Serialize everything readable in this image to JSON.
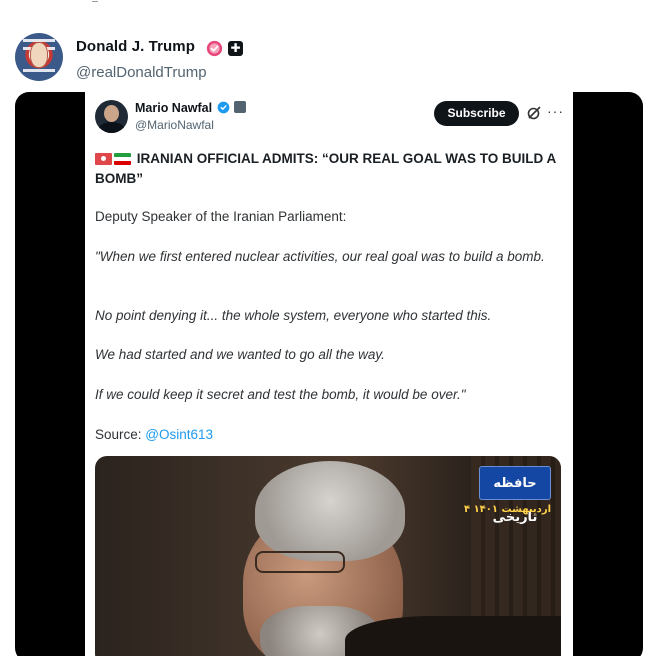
{
  "post": {
    "display_name": "Donald J. Trump",
    "handle": "@realDonaldTrump"
  },
  "quoted_tweet": {
    "name": "Mario Nawfal",
    "handle": "@MarioNawfal",
    "subscribe_label": "Subscribe",
    "more_label": "···",
    "headline": "IRANIAN OFFICIAL ADMITS: “OUR REAL GOAL WAS TO BUILD A BOMB”",
    "intro": "Deputy Speaker of the Iranian Parliament:",
    "quote_1": "\"When we first entered nuclear activities, our real goal was to build a bomb.",
    "quote_2": "No point denying it... the whole system, everyone who started this.",
    "quote_3": "We had started and we wanted to go all the way.",
    "quote_4": "If we could keep it secret and test the bomb, it would be over.\"",
    "source_label": "Source:",
    "source_handle": "@Osint613"
  },
  "video": {
    "logo_text": "حافظه تاریخی",
    "date_text": "۴ اردیبهشت ۱۴۰۱"
  },
  "colors": {
    "link": "#1d9bf0",
    "verified": "#f7a3bc",
    "subscribe_bg": "#0f1419",
    "media_bg": "#000000"
  },
  "icons": [
    "verified-badge-icon",
    "government-badge-icon",
    "grok-icon",
    "more-icon"
  ]
}
